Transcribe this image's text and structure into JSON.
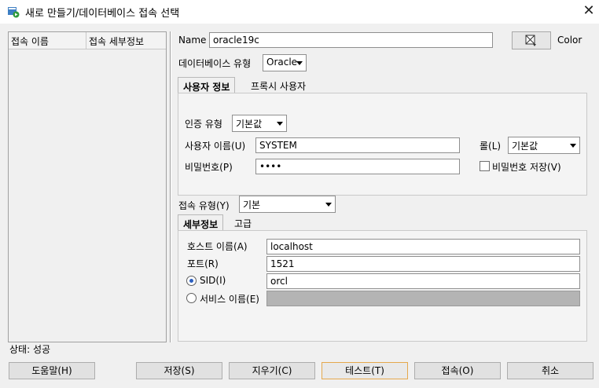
{
  "window": {
    "title": "새로 만들기/데이터베이스 접속 선택",
    "close": "✕"
  },
  "conn_list": {
    "col1": "접속 이름",
    "col2": "접속 세부정보"
  },
  "status": "상태: 성공",
  "form": {
    "name_label": "Name",
    "name_value": "oracle19c",
    "color_label": "Color",
    "db_type_label": "데이터베이스 유형",
    "db_type_value": "Oracle",
    "tabs": [
      "사용자 정보",
      "프록시 사용자"
    ],
    "auth_type_label": "인증 유형",
    "auth_type_value": "기본값",
    "username_label": "사용자 이름(U)",
    "username_value": "SYSTEM",
    "role_label": "롤(L)",
    "role_value": "기본값",
    "password_label": "비밀번호(P)",
    "password_value": "••••",
    "save_password_label": "비밀번호 저장(V)",
    "conn_type_label": "접속 유형(Y)",
    "conn_type_value": "기본",
    "detail_tabs": [
      "세부정보",
      "고급"
    ],
    "host_label": "호스트 이름(A)",
    "host_value": "localhost",
    "port_label": "포트(R)",
    "port_value": "1521",
    "sid_label": "SID(I)",
    "sid_value": "orcl",
    "service_label": "서비스 이름(E)"
  },
  "buttons": {
    "help": "도움말(H)",
    "save": "저장(S)",
    "clear": "지우기(C)",
    "test": "테스트(T)",
    "connect": "접속(O)",
    "cancel": "취소"
  }
}
